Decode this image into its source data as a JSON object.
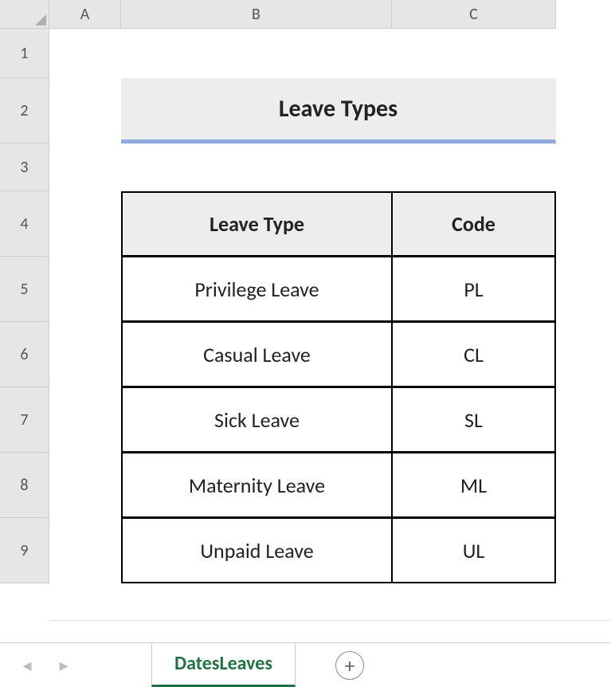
{
  "columns": [
    "A",
    "B",
    "C"
  ],
  "rows": [
    "1",
    "2",
    "3",
    "4",
    "5",
    "6",
    "7",
    "8",
    "9"
  ],
  "title": "Leave Types",
  "headers": {
    "type": "Leave Type",
    "code": "Code"
  },
  "data": [
    {
      "type": "Privilege Leave",
      "code": "PL"
    },
    {
      "type": "Casual Leave",
      "code": "CL"
    },
    {
      "type": "Sick Leave",
      "code": "SL"
    },
    {
      "type": "Maternity Leave",
      "code": "ML"
    },
    {
      "type": "Unpaid Leave",
      "code": "UL"
    }
  ],
  "tab": {
    "active": "DatesLeaves"
  },
  "icons": {
    "prev": "◂",
    "next": "▸",
    "add": "+"
  }
}
